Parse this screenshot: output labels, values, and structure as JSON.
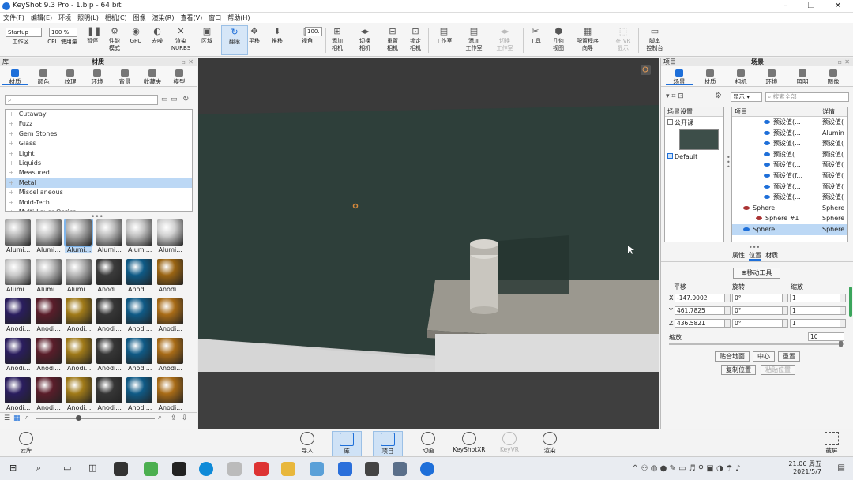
{
  "app": {
    "title": "KeyShot 9.3 Pro  - 1.bip  - 64 bit"
  },
  "menu": [
    "文件(F)",
    "编辑(E)",
    "环境",
    "照明(L)",
    "相机(C)",
    "图像",
    "渲染(R)",
    "查看(V)",
    "窗口",
    "帮助(H)"
  ],
  "toolbar": {
    "workspace_select": "Startup",
    "zoom_select": "100 %",
    "fov_value": "100.",
    "buttons": [
      {
        "label": "工作区",
        "icon": "workspace-icon"
      },
      {
        "label": "CPU 使用量",
        "icon": "cpu-icon"
      },
      {
        "label": "暂停",
        "icon": "pause-icon"
      },
      {
        "label": "性能\n模式",
        "icon": "performance-icon"
      },
      {
        "label": "GPU",
        "icon": "gpu-icon"
      },
      {
        "label": "去噪",
        "icon": "denoise-icon"
      },
      {
        "label": "渲染\nNURBS",
        "icon": "nurbs-icon"
      },
      {
        "label": "区域",
        "icon": "region-icon"
      },
      {
        "label": "翻滚",
        "icon": "tumble-icon"
      },
      {
        "label": "平移",
        "icon": "pan-icon"
      },
      {
        "label": "推移",
        "icon": "dolly-icon"
      },
      {
        "label": "视角",
        "icon": "view-angle-icon"
      },
      {
        "label": "添加\n相机",
        "icon": "add-camera-icon"
      },
      {
        "label": "切换\n相机",
        "icon": "switch-camera-icon"
      },
      {
        "label": "重置\n相机",
        "icon": "reset-camera-icon"
      },
      {
        "label": "锁定\n相机",
        "icon": "lock-camera-icon"
      },
      {
        "label": "工作室",
        "icon": "studio-icon"
      },
      {
        "label": "添加\n工作室",
        "icon": "add-studio-icon"
      },
      {
        "label": "切换\n工作室",
        "icon": "switch-studio-icon"
      },
      {
        "label": "工具",
        "icon": "tools-icon"
      },
      {
        "label": "几何\n视图",
        "icon": "geometry-view-icon"
      },
      {
        "label": "配置程序\n向导",
        "icon": "configurator-icon"
      },
      {
        "label": "在 VR\n显示",
        "icon": "vr-icon"
      },
      {
        "label": "脚本\n控制台",
        "icon": "script-console-icon"
      }
    ]
  },
  "left": {
    "header_library": "库",
    "header_materials": "材质",
    "tabs": [
      "材质",
      "颜色",
      "纹理",
      "环境",
      "背景",
      "收藏夹",
      "模型"
    ],
    "search_placeholder": "",
    "tree": [
      "Cutaway",
      "Fuzz",
      "Gem Stones",
      "Glass",
      "Light",
      "Liquids",
      "Measured",
      "Metal",
      "Miscellaneous",
      "Mold-Tech",
      "Multi-Layer Optics"
    ],
    "selected_tree": "Metal",
    "thumbs": [
      [
        "Alumi...",
        "Alumi...",
        "Alumi...",
        "Alumi...",
        "Alumi...",
        "Alumi..."
      ],
      [
        "Alumi...",
        "Alumi...",
        "Alumi...",
        "Anodi...",
        "Anodi...",
        "Anodi..."
      ],
      [
        "Anodi...",
        "Anodi...",
        "Anodi...",
        "Anodi...",
        "Anodi...",
        "Anodi..."
      ],
      [
        "Anodi...",
        "Anodi...",
        "Anodi...",
        "Anodi...",
        "Anodi...",
        "Anodi..."
      ],
      [
        "Anodi...",
        "Anodi...",
        "Anodi...",
        "Anodi...",
        "Anodi...",
        "Anodi..."
      ]
    ],
    "selected_thumb_index": 2
  },
  "right": {
    "header_project": "项目",
    "header_scene": "场景",
    "tabs": [
      "场景",
      "材质",
      "相机",
      "环境",
      "照明",
      "图像"
    ],
    "show_select": "显示",
    "search_placeholder": "搜索全部",
    "scene_settings": "场景设置",
    "publish_label": "公开课",
    "default_label": "Default",
    "tree_col_project": "项目",
    "tree_col_detail": "详情",
    "tree_rows": [
      {
        "name": "预设值(...",
        "detail": "预设值("
      },
      {
        "name": "预设值(...",
        "detail": "Alumin"
      },
      {
        "name": "预设值(...",
        "detail": "预设值("
      },
      {
        "name": "预设值(...",
        "detail": "预设值("
      },
      {
        "name": "预设值(...",
        "detail": "预设值("
      },
      {
        "name": "预设值(f...",
        "detail": "预设值("
      },
      {
        "name": "预设值(...",
        "detail": "预设值("
      },
      {
        "name": "预设值(...",
        "detail": "预设值("
      },
      {
        "name": "Sphere",
        "detail": "Sphere"
      },
      {
        "name": "Sphere #1",
        "detail": "Sphere"
      },
      {
        "name": "Sphere",
        "detail": "Sphere"
      }
    ],
    "subtabs": [
      "属性",
      "位置",
      "材质"
    ],
    "move_tool": "移动工具",
    "col_translate": "平移",
    "col_rotate": "旋转",
    "col_scale": "缩放",
    "axes": [
      "X",
      "Y",
      "Z"
    ],
    "translate": [
      "-147.0002",
      "461.7825",
      "436.5821"
    ],
    "rotate": [
      "0°",
      "0°",
      "0°"
    ],
    "scale": [
      "1",
      "1",
      "1"
    ],
    "uniform_scale_label": "缩放",
    "uniform_scale_value": "10",
    "uniform_scale_fraction": 0.98,
    "btn_snap": "贴合地面",
    "btn_center": "中心",
    "btn_reset": "重置",
    "btn_copy": "复制位置",
    "btn_paste": "粘贴位置"
  },
  "bottom": {
    "cloud": "云库",
    "items": [
      {
        "label": "导入",
        "icon": "import-icon"
      },
      {
        "label": "库",
        "icon": "library-icon"
      },
      {
        "label": "项目",
        "icon": "project-icon"
      },
      {
        "label": "动画",
        "icon": "animation-icon"
      },
      {
        "label": "KeyShotXR",
        "icon": "keyshotxr-icon"
      },
      {
        "label": "KeyVR",
        "icon": "keyvr-icon"
      },
      {
        "label": "渲染",
        "icon": "render-icon"
      }
    ],
    "screenshot": "截屏"
  },
  "taskbar": {
    "time": "21:06 周五",
    "date": "2021/5/7"
  },
  "colors": {
    "accent": "#1e6fd9",
    "wall": "#2e3f3a",
    "floor": "#cfcfcf"
  }
}
